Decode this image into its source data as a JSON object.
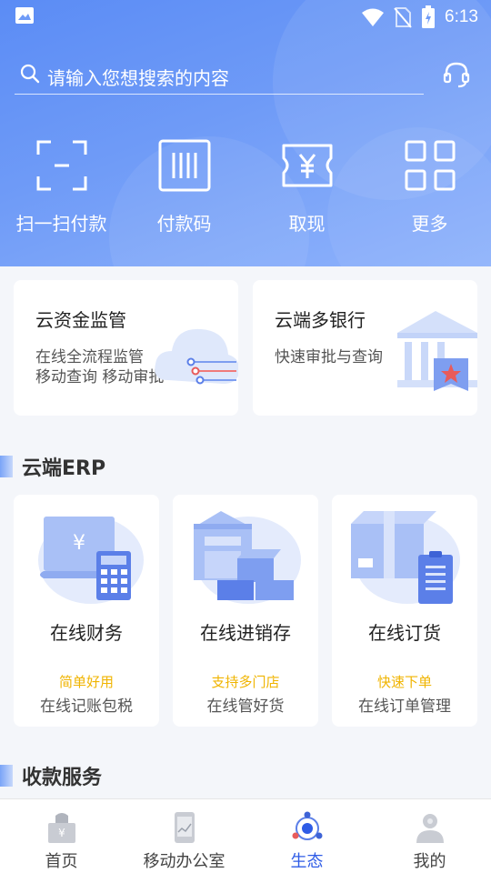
{
  "status_bar": {
    "time": "6:13"
  },
  "search": {
    "placeholder": "请输入您想搜索的内容"
  },
  "quick_actions": [
    {
      "label": "扫一扫付款",
      "icon": "scan-icon"
    },
    {
      "label": "付款码",
      "icon": "barcode-icon"
    },
    {
      "label": "取现",
      "icon": "cash-ticket-icon"
    },
    {
      "label": "更多",
      "icon": "grid-more-icon"
    }
  ],
  "feature_cards": [
    {
      "title": "云资金监管",
      "lines": [
        "在线全流程监管",
        "移动查询 移动审批"
      ]
    },
    {
      "title": "云端多银行",
      "lines": [
        "快速审批与查询"
      ]
    }
  ],
  "sections": {
    "erp_title": "云端ERP",
    "payment_title": "收款服务"
  },
  "erp_cards": [
    {
      "title": "在线财务",
      "tag": "简单好用",
      "desc": "在线记账包税"
    },
    {
      "title": "在线进销存",
      "tag": "支持多门店",
      "desc": "在线管好货"
    },
    {
      "title": "在线订货",
      "tag": "快速下单",
      "desc": "在线订单管理"
    }
  ],
  "bottom_nav": [
    {
      "label": "首页",
      "active": false
    },
    {
      "label": "移动办公室",
      "active": false
    },
    {
      "label": "生态",
      "active": true
    },
    {
      "label": "我的",
      "active": false
    }
  ],
  "colors": {
    "accent": "#2f5ce6",
    "header_blue": "#6f9bf7",
    "tag_yellow": "#f0b400"
  }
}
